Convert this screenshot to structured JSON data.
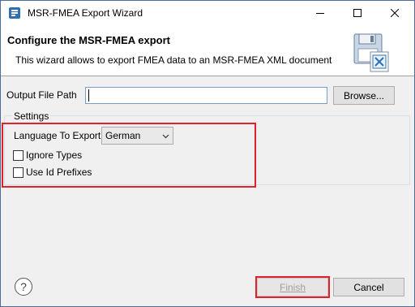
{
  "window": {
    "title": "MSR-FMEA Export Wizard",
    "accent_color": "#4a6d99",
    "app_icon": "eclipse-app-icon"
  },
  "banner": {
    "title": "Configure the MSR-FMEA export",
    "description": "This wizard allows to export FMEA data to an MSR-FMEA XML document",
    "image_icon": "floppy-excel-export-icon"
  },
  "output": {
    "label": "Output File Path",
    "value": "",
    "browse_label": "Browse..."
  },
  "settings": {
    "group_label": "Settings",
    "language_label": "Language To Export",
    "language_value": "German",
    "ignore_types_label": "Ignore Types",
    "ignore_types_checked": false,
    "use_id_prefixes_label": "Use Id Prefixes",
    "use_id_prefixes_checked": false
  },
  "footer": {
    "help_glyph": "?",
    "finish_label": "Finish",
    "cancel_label": "Cancel",
    "finish_enabled": false
  },
  "highlight_color": "#e0202a"
}
